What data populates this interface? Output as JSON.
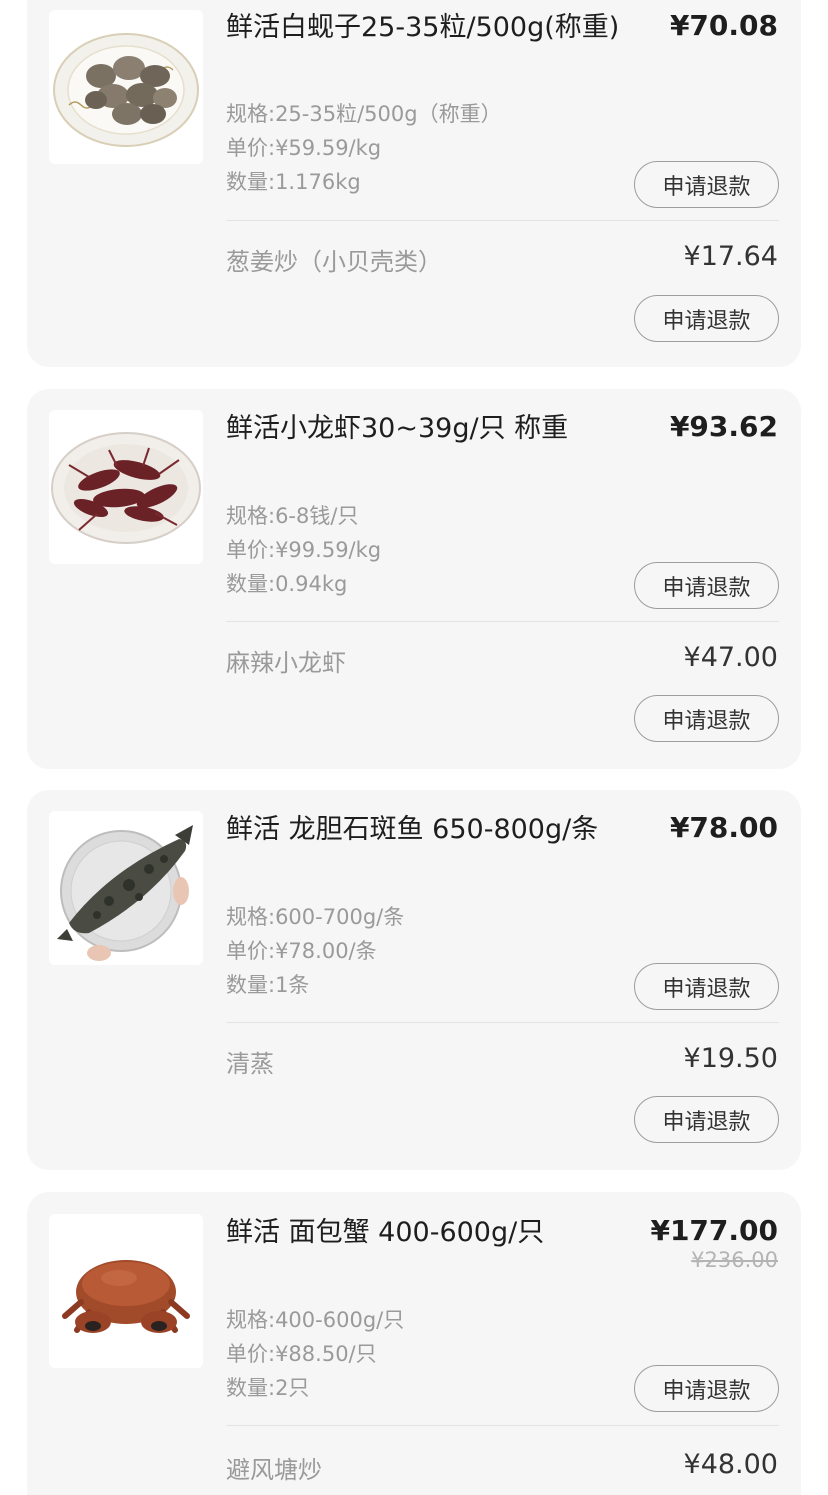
{
  "items": [
    {
      "image_icon": "clams-plate-image",
      "title": "鲜活白蚬子25-35粒/500g(称重)",
      "price": "¥70.08",
      "spec": "规格:25-35粒/500g（称重）",
      "unit_price": "单价:¥59.59/kg",
      "quantity": "数量:1.176kg",
      "refund_label": "申请退款",
      "addon": {
        "name": "葱姜炒（小贝壳类）",
        "price": "¥17.64",
        "refund_label": "申请退款"
      }
    },
    {
      "image_icon": "crayfish-plate-image",
      "title": "鲜活小龙虾30~39g/只 称重",
      "price": "¥93.62",
      "spec": "规格:6-8钱/只",
      "unit_price": "单价:¥99.59/kg",
      "quantity": "数量:0.94kg",
      "refund_label": "申请退款",
      "addon": {
        "name": "麻辣小龙虾",
        "price": "¥47.00",
        "refund_label": "申请退款"
      }
    },
    {
      "image_icon": "grouper-fish-image",
      "title": "鲜活 龙胆石斑鱼 650-800g/条",
      "price": "¥78.00",
      "spec": "规格:600-700g/条",
      "unit_price": "单价:¥78.00/条",
      "quantity": "数量:1条",
      "refund_label": "申请退款",
      "addon": {
        "name": "清蒸",
        "price": "¥19.50",
        "refund_label": "申请退款"
      }
    },
    {
      "image_icon": "brown-crab-image",
      "title": "鲜活 面包蟹 400-600g/只",
      "price": "¥177.00",
      "original_price": "¥236.00",
      "spec": "规格:400-600g/只",
      "unit_price": "单价:¥88.50/只",
      "quantity": "数量:2只",
      "refund_label": "申请退款",
      "addon": {
        "name": "避风塘炒",
        "price": "¥48.00"
      }
    }
  ],
  "colors": {
    "card_bg": "#f6f6f6",
    "text_primary": "#1e1e1e",
    "text_secondary": "#9a9a9a",
    "button_border": "#9d9d9d"
  }
}
